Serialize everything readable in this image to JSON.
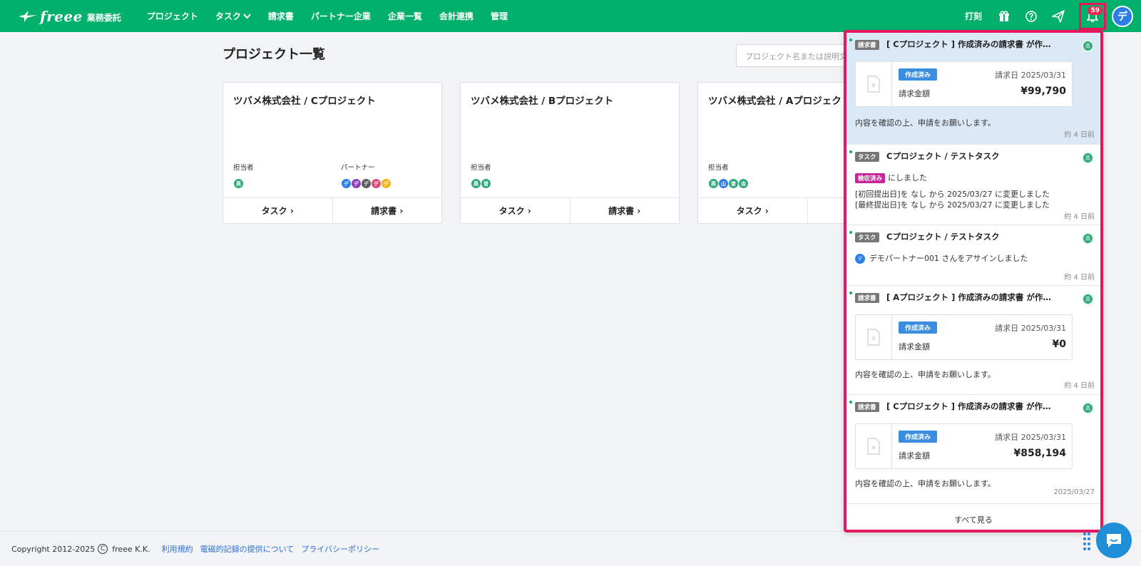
{
  "header": {
    "brand": "freee",
    "product": "業務委託",
    "nav": [
      {
        "label": "プロジェクト"
      },
      {
        "label": "タスク"
      },
      {
        "label": "請求書"
      },
      {
        "label": "パートナー企業"
      },
      {
        "label": "企業一覧"
      },
      {
        "label": "会計連携"
      },
      {
        "label": "管理"
      }
    ],
    "punch_label": "打刻",
    "notification_count": "59",
    "user_initial": "デ"
  },
  "main": {
    "title": "プロジェクト一覧",
    "search_placeholder": "プロジェクト名または説明文",
    "cards": [
      {
        "title": "ツバメ株式会社 / Cプロジェクト",
        "owner_label": "担当者",
        "partner_label": "パートナー",
        "owners": [
          "高"
        ],
        "partners": [
          "デ",
          "デ",
          "デ",
          "デ",
          "デ"
        ],
        "task_label": "タスク",
        "invoice_label": "請求書"
      },
      {
        "title": "ツバメ株式会社 / Bプロジェクト",
        "owner_label": "担当者",
        "owners": [
          "高",
          "曽"
        ],
        "task_label": "タスク",
        "invoice_label": "請求書"
      },
      {
        "title": "ツバメ株式会社 / Aプロジェクト",
        "owner_label": "担当者",
        "owners": [
          "高",
          "山",
          "曽",
          "会"
        ],
        "task_label": "タスク"
      }
    ]
  },
  "notifications": [
    {
      "tag": "請求書",
      "title": "[ Cプロジェクト ] 作成済みの請求書 が作…",
      "status": "作成済み",
      "date": "請求日 2025/03/31",
      "amount_label": "請求金額",
      "amount": "¥99,790",
      "message": "内容を確認の上、申請をお願いします。",
      "time": "約 4 日前",
      "avatar": "高"
    },
    {
      "tag": "タスク",
      "title": "Cプロジェクト / テストタスク",
      "status": "検収済み",
      "status_suffix": "にしました",
      "line1": "[初回提出日]を なし から 2025/03/27 に変更しました",
      "line2": "[最終提出日]を なし から 2025/03/27 に変更しました",
      "time": "約 4 日前",
      "avatar": "高"
    },
    {
      "tag": "タスク",
      "title": "Cプロジェクト / テストタスク",
      "assign_avatar": "デ",
      "message": "デモパートナー001 さんをアサインしました",
      "time": "約 4 日前",
      "avatar": "高"
    },
    {
      "tag": "請求書",
      "title": "[ Aプロジェクト ] 作成済みの請求書 が作…",
      "status": "作成済み",
      "date": "請求日 2025/03/31",
      "amount_label": "請求金額",
      "amount": "¥0",
      "message": "内容を確認の上、申請をお願いします。",
      "time": "約 4 日前",
      "avatar": "高"
    },
    {
      "tag": "請求書",
      "title": "[ Cプロジェクト ] 作成済みの請求書 が作…",
      "status": "作成済み",
      "date": "請求日 2025/03/31",
      "amount_label": "請求金額",
      "amount": "¥858,194",
      "message": "内容を確認の上、申請をお願いします。",
      "time": "2025/03/27",
      "avatar": "高"
    }
  ],
  "see_all_label": "すべて見る",
  "footer": {
    "copyright": "Copyright 2012-2025",
    "copyright_symbol": "C",
    "company": "freee K.K.",
    "links": [
      "利用規約",
      "電磁的記録の提供について",
      "プライバシーポリシー"
    ]
  },
  "colors": {
    "brand_green": "#00b06b",
    "highlight_border": "#e8175d",
    "notification_unread_bg": "#dbe9f7",
    "link_blue": "#2b6fd6"
  }
}
